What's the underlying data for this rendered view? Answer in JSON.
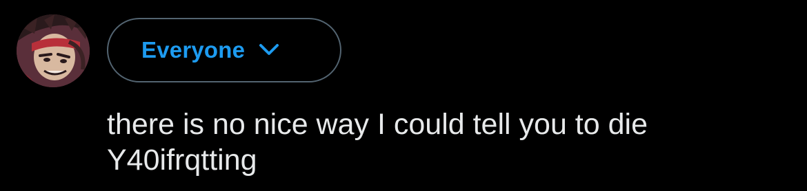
{
  "theme": {
    "background": "#000000",
    "accent": "#1d9bf0",
    "border": "#536471",
    "text": "#e7e9ea"
  },
  "avatar": {
    "icon": "user-avatar"
  },
  "audience": {
    "label": "Everyone",
    "icon": "chevron-down-icon"
  },
  "composer": {
    "lines": [
      "there is no nice way I could tell you to die",
      "Y40ifrqtting"
    ]
  }
}
